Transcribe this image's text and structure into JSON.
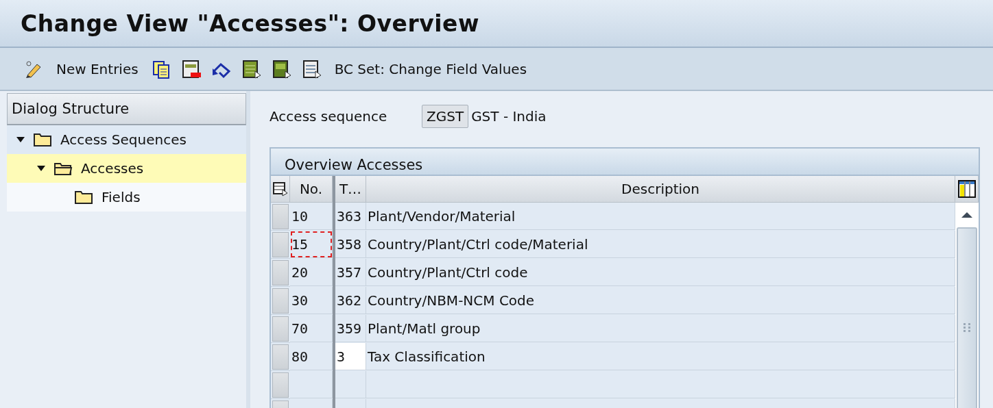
{
  "window": {
    "title": "Change View \"Accesses\": Overview"
  },
  "toolbar": {
    "items": [
      {
        "kind": "icon"
      },
      {
        "kind": "text",
        "label": "New Entries"
      },
      {
        "kind": "icon"
      },
      {
        "kind": "icon"
      },
      {
        "kind": "icon"
      },
      {
        "kind": "icon"
      },
      {
        "kind": "icon"
      },
      {
        "kind": "icon"
      },
      {
        "kind": "text",
        "label": "BC Set: Change Field Values"
      }
    ]
  },
  "sidebar": {
    "title": "Dialog Structure",
    "items": [
      {
        "label": "Access Sequences",
        "expanded": true,
        "selected": false,
        "children": [
          {
            "label": "Accesses",
            "expanded": true,
            "selected": true,
            "children": [
              {
                "label": "Fields",
                "selected": false
              }
            ]
          }
        ]
      }
    ]
  },
  "header": {
    "label": "Access sequence",
    "code": "ZGST",
    "text": "GST - India"
  },
  "table": {
    "title": "Overview Accesses",
    "columns": [
      "No.",
      "T…",
      "Description"
    ],
    "rows": [
      {
        "no": "10",
        "t": "363",
        "description": "Plant/Vendor/Material",
        "focused": false,
        "t_editable": false
      },
      {
        "no": "15",
        "t": "358",
        "description": "Country/Plant/Ctrl code/Material",
        "focused": true,
        "t_editable": false
      },
      {
        "no": "20",
        "t": "357",
        "description": "Country/Plant/Ctrl code",
        "focused": false,
        "t_editable": false
      },
      {
        "no": "30",
        "t": "362",
        "description": "Country/NBM-NCM Code",
        "focused": false,
        "t_editable": false
      },
      {
        "no": "70",
        "t": "359",
        "description": "Plant/Matl group",
        "focused": false,
        "t_editable": false
      },
      {
        "no": "80",
        "t": "3",
        "description": "Tax Classification",
        "focused": false,
        "t_editable": true
      }
    ]
  }
}
